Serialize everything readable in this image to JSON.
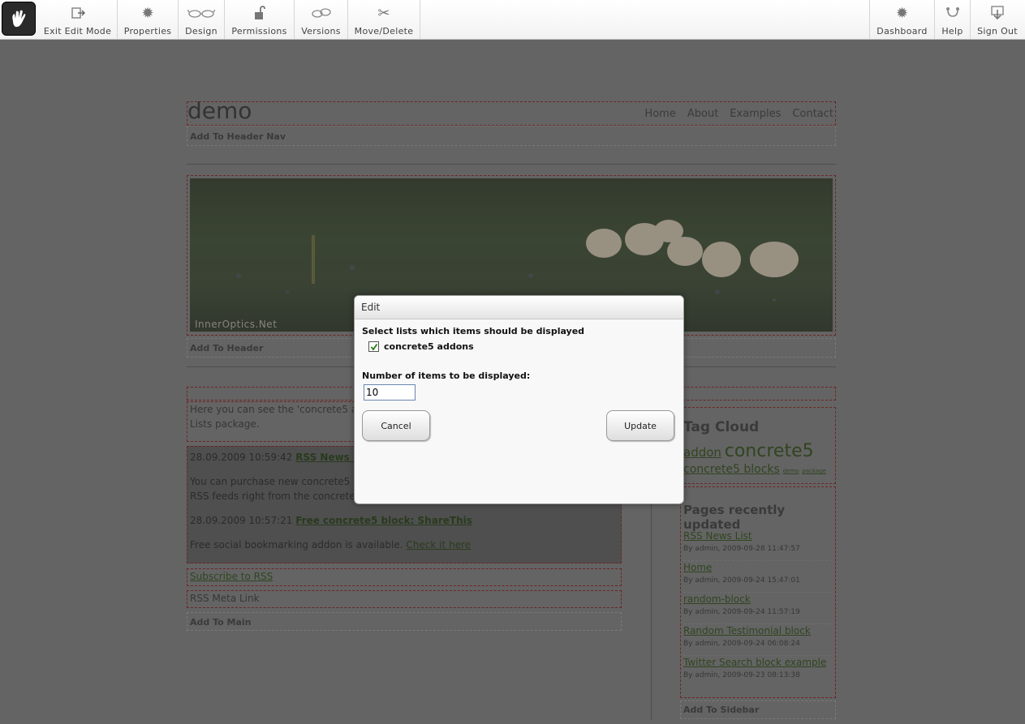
{
  "toolbar": {
    "left": [
      {
        "label": "Exit Edit Mode",
        "icon": "exit-edit-icon"
      },
      {
        "label": "Properties",
        "icon": "properties-icon"
      },
      {
        "label": "Design",
        "icon": "design-glasses-icon"
      },
      {
        "label": "Permissions",
        "icon": "lock-icon"
      },
      {
        "label": "Versions",
        "icon": "versions-icon"
      },
      {
        "label": "Move/Delete",
        "icon": "scissors-icon"
      }
    ],
    "right": [
      {
        "label": "Dashboard",
        "icon": "dashboard-icon"
      },
      {
        "label": "Help",
        "icon": "help-icon"
      },
      {
        "label": "Sign Out",
        "icon": "sign-out-icon"
      }
    ]
  },
  "site": {
    "title": "demo",
    "nav": [
      "Home",
      "About",
      "Examples",
      "Contact"
    ],
    "add_header_nav": "Add To Header Nav",
    "banner_caption": "InnerOptics.Net",
    "add_header": "Add To Header",
    "intro_text": "Here you can see the 'concrete5 a",
    "intro_text2": "Lists package.",
    "news": [
      {
        "date": "28.09.2009 10:59:42",
        "title": "RSS News Li",
        "body": "You can purchase new concrete5",
        "body2": "RSS feeds right from the concrete5"
      },
      {
        "date": "28.09.2009 10:57:21",
        "title": "Free concrete5 block: ShareThis",
        "body": "Free social bookmarking addon is available.",
        "link": "Check it here"
      }
    ],
    "subscribe": "Subscribe to RSS",
    "rss_meta": "RSS Meta Link",
    "add_main": "Add To Main",
    "tag_cloud_title": "Tag Cloud",
    "tags": [
      {
        "text": "addon",
        "size": 15
      },
      {
        "text": "concrete5",
        "size": 22
      },
      {
        "text": "concrete5 blocks",
        "size": 14
      },
      {
        "text": "demo",
        "size": 7
      },
      {
        "text": "package",
        "size": 7
      }
    ],
    "pages_title": "Pages recently updated",
    "pages": [
      {
        "name": "RSS News List",
        "meta": "By admin, 2009-09-28 11:47:57"
      },
      {
        "name": "Home",
        "meta": "By admin, 2009-09-24 15:47:01"
      },
      {
        "name": "random-block",
        "meta": "By admin, 2009-09-24 11:57:19"
      },
      {
        "name": "Random Testimonial block",
        "meta": "By admin, 2009-09-24 06:08:24"
      },
      {
        "name": "Twitter Search block example",
        "meta": "By admin, 2009-09-23 08:13:38"
      }
    ],
    "add_sidebar": "Add To Sidebar"
  },
  "modal": {
    "title": "Edit",
    "lists_label": "Select lists which items should be displayed",
    "list_option": "concrete5 addons",
    "list_checked": true,
    "count_label": "Number of items to be displayed:",
    "count_value": "10",
    "cancel": "Cancel",
    "update": "Update"
  }
}
